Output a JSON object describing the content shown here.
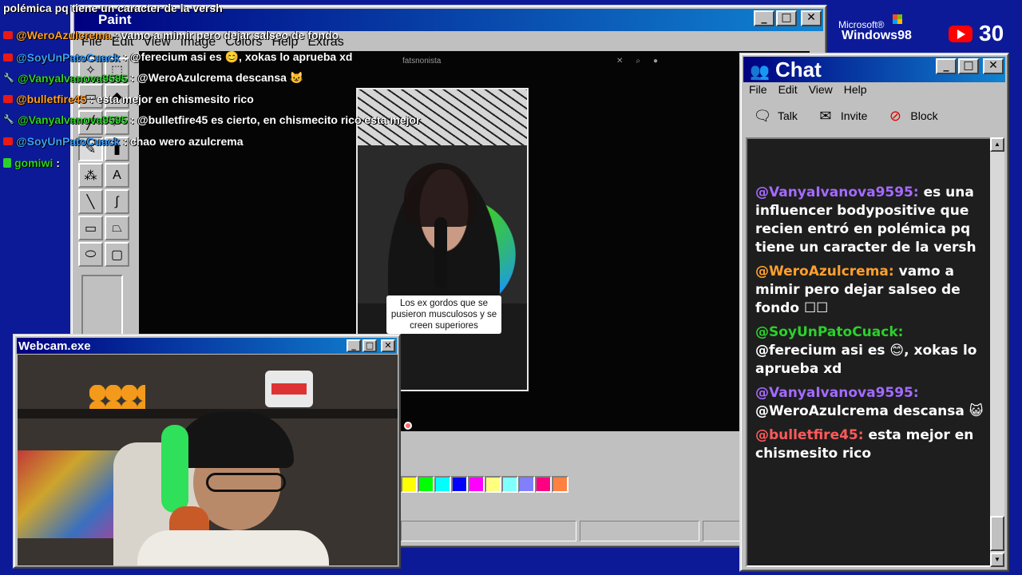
{
  "paint": {
    "title": "Paint",
    "menus": [
      "File",
      "Edit",
      "View",
      "Image",
      "Colors",
      "Help",
      "Extras"
    ],
    "tools": [
      "select-star",
      "select-rect",
      "eraser",
      "fill",
      "picker",
      "magnifier",
      "pencil",
      "brush",
      "airbrush",
      "text",
      "line",
      "curve",
      "rectangle",
      "polygon",
      "ellipse",
      "rounded-rect"
    ],
    "tool_text_glyph": "A",
    "video_search_text": "fatsnonista",
    "video_caption": "Los ex gordos que se pusieron musculosos y se creen superiores",
    "palette": [
      "#ffff00",
      "#00ff00",
      "#00ffff",
      "#0000ff",
      "#ff00ff",
      "#ffff80",
      "#80ffff",
      "#8080ff",
      "#ff0080",
      "#ff8040"
    ]
  },
  "overlay_chat": {
    "lines": [
      {
        "user": "",
        "message": "polémica pq tiene un caracter de la versh",
        "badge": "none"
      },
      {
        "user": "@WeroAzulcrema",
        "message": ": vamo a mimir pero dejar salseo de fondo",
        "badge": "red"
      },
      {
        "user": "@SoyUnPatoCuack",
        "message": ": @ferecium asi es 😊, xokas lo aprueba xd",
        "badge": "red"
      },
      {
        "user": "@Vanyalvanova9595",
        "message": ": @WeroAzulcrema descansa 😺",
        "badge": "wrench"
      },
      {
        "user": "@bulletfire45",
        "message": ": esta mejor en chismesito rico",
        "badge": "red"
      },
      {
        "user": "@Vanyalvanova9595",
        "message": ": @bulletfire45 es cierto, en chismecito rico esta mejor",
        "badge": "wrench"
      },
      {
        "user": "@SoyUnPatoCuack",
        "message": ": chao wero azulcrema",
        "badge": "red"
      },
      {
        "user": "gomiwi",
        "message": ":",
        "badge": "green"
      }
    ],
    "user_colors": {
      "@WeroAzulcrema": "#ff9f2e",
      "@SoyUnPatoCuack": "#3aa0ff",
      "@Vanyalvanova9595": "#2bd12b",
      "@bulletfire45": "#ff9f2e",
      "gomiwi": "#2bd12b"
    }
  },
  "branding": {
    "ms_text": "Microsoft®",
    "windows_text": "Windows98",
    "youtube_count": "30"
  },
  "chat": {
    "title": "Chat",
    "menus": [
      "File",
      "Edit",
      "View",
      "Help"
    ],
    "toolbar": [
      {
        "label": "Talk",
        "icon": "talk-icon"
      },
      {
        "label": "Invite",
        "icon": "invite-icon"
      },
      {
        "label": "Block",
        "icon": "block-icon"
      }
    ],
    "messages": [
      {
        "user": "@VanyaIvanova9595:",
        "text": "es una influencer bodypositive que recien entró en polémica pq tiene un caracter de la versh"
      },
      {
        "user": "@WeroAzulcrema:",
        "text": "vamo a mimir pero dejar salseo de fondo ☐☐"
      },
      {
        "user": "@SoyUnPatoCuack:",
        "text": "@ferecium asi es 😊, xokas lo aprueba xd"
      },
      {
        "user": "@VanyaIvanova9595:",
        "text": "@WeroAzulcrema descansa 😺"
      },
      {
        "user": "@bulletfire45:",
        "text": "esta mejor en chismesito rico"
      }
    ],
    "user_colors": {
      "@VanyaIvanova9595:": "#a46bff",
      "@WeroAzulcrema:": "#ff9f2e",
      "@SoyUnPatoCuack:": "#2bd12b",
      "@bulletfire45:": "#ff5a5a"
    }
  },
  "webcam": {
    "title": "Webcam.exe"
  },
  "window_buttons": {
    "minimize": "_",
    "maximize": "□",
    "close": "✕"
  }
}
